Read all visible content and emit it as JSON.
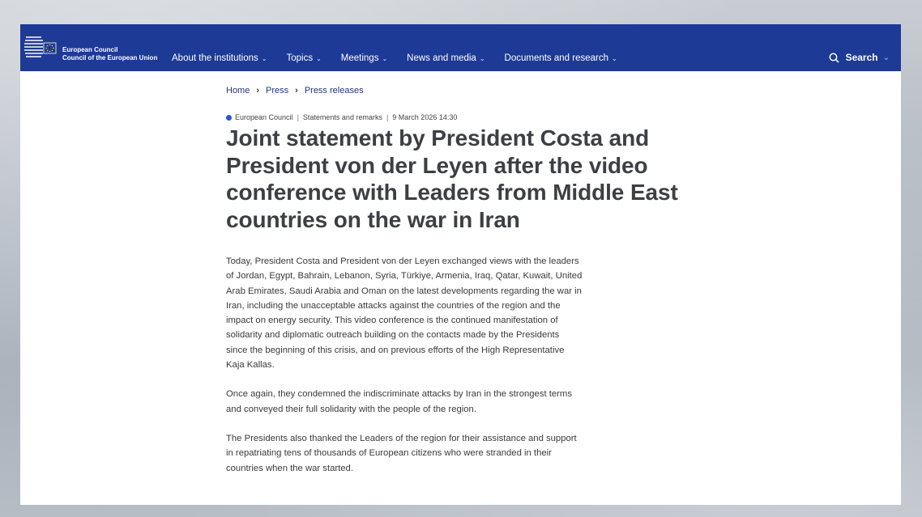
{
  "header": {
    "brand_line1": "European Council",
    "brand_line2": "Council of the European Union",
    "nav": [
      {
        "label": "About the institutions"
      },
      {
        "label": "Topics"
      },
      {
        "label": "Meetings"
      },
      {
        "label": "News and media"
      },
      {
        "label": "Documents and research"
      }
    ],
    "search_label": "Search",
    "colors": {
      "bar": "#1d3a96"
    }
  },
  "breadcrumb": [
    "Home",
    "Press",
    "Press releases"
  ],
  "meta": {
    "category": "European Council",
    "type": "Statements and remarks",
    "date": "9 March 2026 14:30"
  },
  "article": {
    "title": "Joint statement by President Costa and President von der Leyen after the video conference with Leaders from Middle East countries on the war in Iran",
    "paragraphs": [
      "Today, President Costa and President von der Leyen exchanged views with the leaders of Jordan, Egypt, Bahrain, Lebanon, Syria, Türkiye, Armenia, Iraq, Qatar, Kuwait, United Arab Emirates, Saudi Arabia and Oman on the latest developments regarding the war in Iran, including the unacceptable attacks against the countries of the region and the impact on energy security. This video conference is the continued manifestation of solidarity and diplomatic outreach building on the contacts made by the Presidents since the beginning of this crisis, and on previous efforts of the High Representative Kaja Kallas.",
      "Once again, they condemned the indiscriminate attacks by Iran in the strongest terms and conveyed their full solidarity with the people of the region.",
      "The Presidents also thanked the Leaders of the region for their assistance and support in repatriating tens of thousands of European citizens who were stranded in their countries when the war started."
    ]
  }
}
